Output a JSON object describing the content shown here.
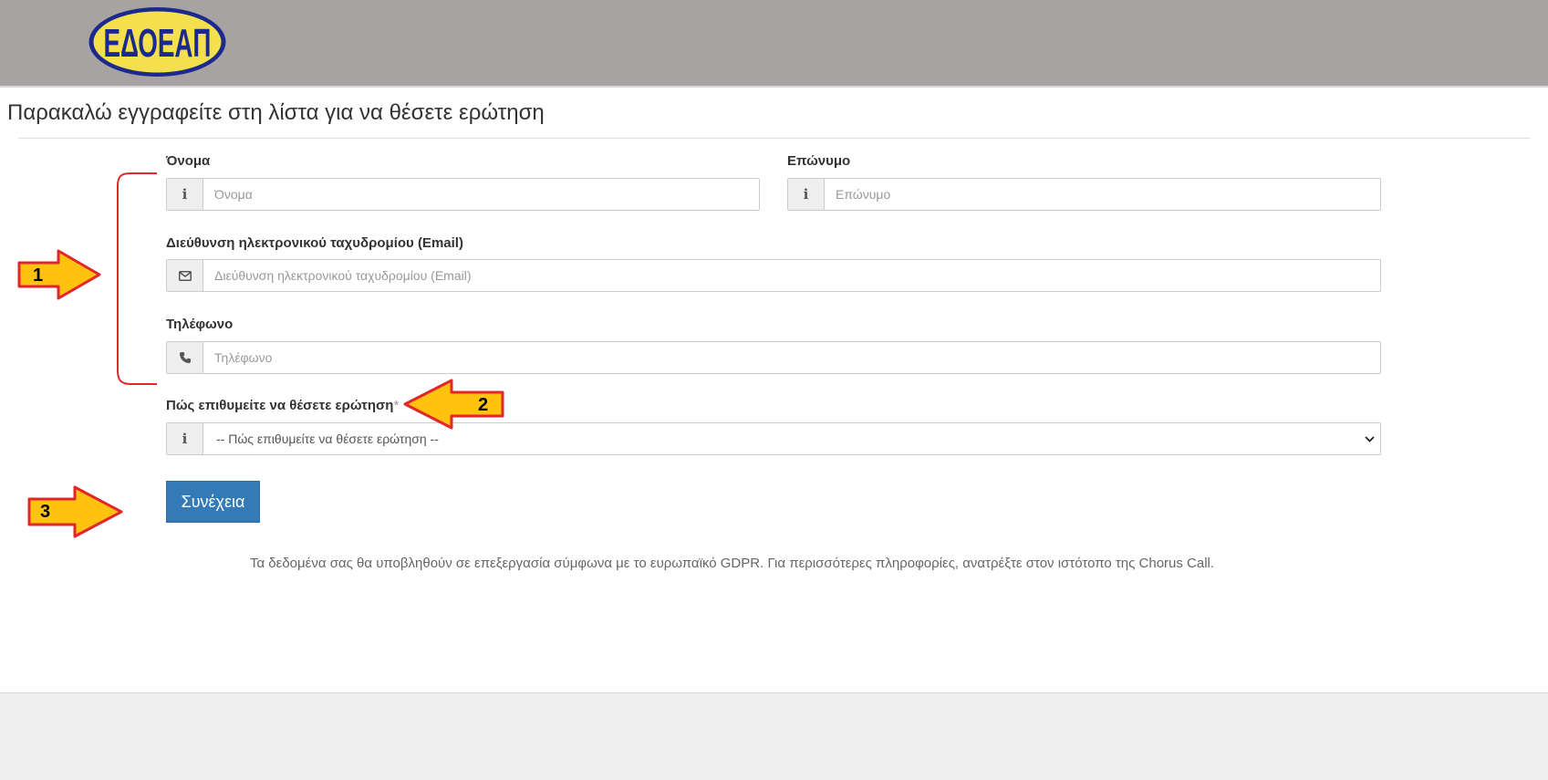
{
  "header": {
    "logo_text": "ΕΔΟΕΑΠ",
    "logo_bg": "#f4e04d",
    "logo_fg": "#1b2a8c"
  },
  "page": {
    "title": "Παρακαλώ εγγραφείτε στη λίστα για να θέσετε ερώτηση"
  },
  "form": {
    "first_name": {
      "label": "Όνομα",
      "placeholder": "Όνομα",
      "icon": "info-icon"
    },
    "last_name": {
      "label": "Επώνυμο",
      "placeholder": "Επώνυμο",
      "icon": "info-icon"
    },
    "email": {
      "label": "Διεύθυνση ηλεκτρονικού ταχυδρομίου (Email)",
      "placeholder": "Διεύθυνση ηλεκτρονικού ταχυδρομίου (Email)",
      "icon": "envelope-icon"
    },
    "phone": {
      "label": "Τηλέφωνο",
      "placeholder": "Τηλέφωνο",
      "icon": "phone-icon"
    },
    "question_mode": {
      "label": "Πώς επιθυμείτε να θέσετε ερώτηση",
      "required_mark": "*",
      "selected": "-- Πώς επιθυμείτε να θέσετε ερώτηση --",
      "icon": "info-icon"
    },
    "submit_label": "Συνέχεια"
  },
  "note": "Τα δεδομένα σας θα υποβληθούν σε επεξεργασία σύμφωνα με το ευρωπαϊκό GDPR. Για περισσότερες πληροφορίες, ανατρέξτε στον ιστότοπο της Chorus Call.",
  "annotations": {
    "arrow1": "1",
    "arrow2": "2",
    "arrow3": "3",
    "arrow_fill": "#ffc20e",
    "arrow_stroke": "#e3262a"
  },
  "colors": {
    "primary": "#337ab7",
    "header_bg": "#a8a3a3"
  }
}
